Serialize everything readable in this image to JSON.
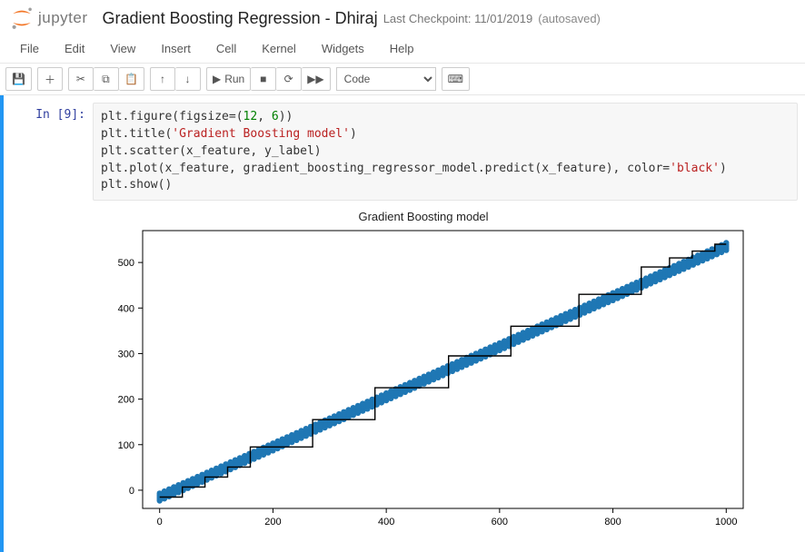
{
  "header": {
    "app_name": "jupyter",
    "title": "Gradient Boosting Regression - Dhiraj",
    "checkpoint_label": "Last Checkpoint: 11/01/2019",
    "autosaved_label": "(autosaved)"
  },
  "menubar": [
    "File",
    "Edit",
    "View",
    "Insert",
    "Cell",
    "Kernel",
    "Widgets",
    "Help"
  ],
  "toolbar": {
    "run_label": "Run",
    "celltype_value": "Code"
  },
  "cell": {
    "prompt": "In [9]:",
    "code_lines": [
      {
        "segments": [
          {
            "t": "plt.figure(figsize=("
          },
          {
            "t": "12",
            "cls": "tok-num"
          },
          {
            "t": ", "
          },
          {
            "t": "6",
            "cls": "tok-num"
          },
          {
            "t": "))"
          }
        ]
      },
      {
        "segments": [
          {
            "t": "plt.title("
          },
          {
            "t": "'Gradient Boosting model'",
            "cls": "tok-str"
          },
          {
            "t": ")"
          }
        ]
      },
      {
        "segments": [
          {
            "t": "plt.scatter(x_feature, y_label)"
          }
        ]
      },
      {
        "segments": [
          {
            "t": "plt.plot(x_feature, gradient_boosting_regressor_model.predict(x_feature), color="
          },
          {
            "t": "'black'",
            "cls": "tok-str"
          },
          {
            "t": ")"
          }
        ]
      },
      {
        "segments": [
          {
            "t": "plt.show()"
          }
        ]
      }
    ]
  },
  "chart_data": {
    "type": "line+scatter",
    "title": "Gradient Boosting model",
    "xlabel": "",
    "ylabel": "",
    "xlim": [
      -30,
      1030
    ],
    "ylim": [
      -40,
      570
    ],
    "xticks": [
      0,
      200,
      400,
      600,
      800,
      1000
    ],
    "yticks": [
      0,
      100,
      200,
      300,
      400,
      500
    ],
    "scatter": {
      "desc": "thick diagonal band of blue points approximating y ≈ 0.55*x - 15",
      "x_range": [
        0,
        1000
      ],
      "count_approx": 300,
      "slope": 0.55,
      "intercept": -15,
      "color": "#1f77b4"
    },
    "step_line": {
      "desc": "black step-function prediction of gradient boosting regressor",
      "color": "#000000",
      "points": [
        [
          0,
          -15
        ],
        [
          40,
          -15
        ],
        [
          40,
          7
        ],
        [
          80,
          7
        ],
        [
          80,
          29
        ],
        [
          120,
          29
        ],
        [
          120,
          51
        ],
        [
          160,
          51
        ],
        [
          160,
          95
        ],
        [
          270,
          95
        ],
        [
          270,
          155
        ],
        [
          380,
          155
        ],
        [
          380,
          225
        ],
        [
          510,
          225
        ],
        [
          510,
          295
        ],
        [
          620,
          295
        ],
        [
          620,
          360
        ],
        [
          740,
          360
        ],
        [
          740,
          430
        ],
        [
          850,
          430
        ],
        [
          850,
          490
        ],
        [
          900,
          490
        ],
        [
          900,
          510
        ],
        [
          940,
          510
        ],
        [
          940,
          525
        ],
        [
          980,
          525
        ],
        [
          980,
          540
        ],
        [
          1000,
          540
        ]
      ]
    }
  }
}
